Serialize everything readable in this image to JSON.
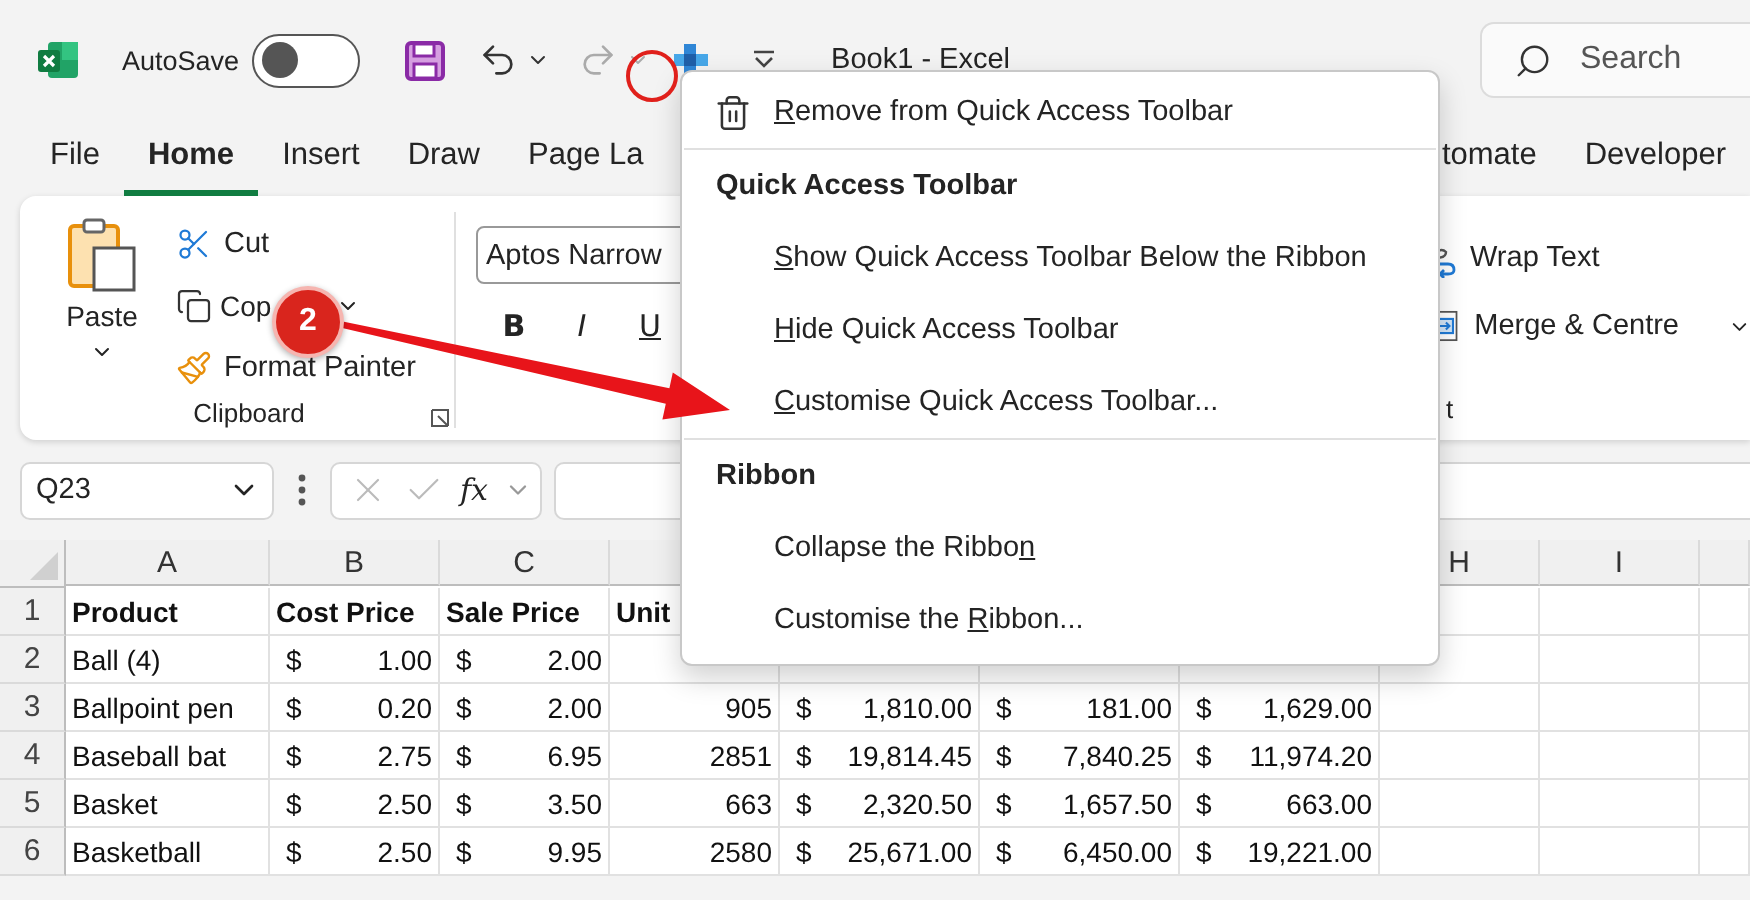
{
  "title_bar": {
    "autosave_label": "AutoSave",
    "autosave_on": false,
    "title": "Book1  -  Excel",
    "search": {
      "placeholder": "Search"
    }
  },
  "tabs": [
    {
      "label": "File",
      "selected": false
    },
    {
      "label": "Home",
      "selected": true
    },
    {
      "label": "Insert",
      "selected": false
    },
    {
      "label": "Draw",
      "selected": false
    },
    {
      "label": "Page La",
      "selected": false
    },
    {
      "label": "tomate",
      "selected": false
    },
    {
      "label": "Developer",
      "selected": false
    }
  ],
  "ribbon": {
    "clipboard": {
      "paste": "Paste",
      "cut": "Cut",
      "copy": "Cop",
      "format_painter": "Format Painter",
      "label": "Clipboard"
    },
    "font": {
      "name": "Aptos Narrow",
      "bold": "B",
      "italic": "I",
      "underline": "U"
    },
    "alignment": {
      "wrap_text": "Wrap Text",
      "merge": "Merge & Centre",
      "label": "t"
    }
  },
  "formula_bar": {
    "name_box": "Q23",
    "fx": "fx"
  },
  "sheet": {
    "columns": [
      "A",
      "B",
      "C",
      "H",
      "I"
    ],
    "rows": [
      {
        "number": "1",
        "cells": [
          {
            "kind": "header",
            "text": "Product"
          },
          {
            "kind": "header",
            "text": "Cost Price"
          },
          {
            "kind": "header",
            "text": "Sale Price"
          },
          {
            "kind": "header",
            "text": "Unit"
          }
        ]
      },
      {
        "number": "2",
        "cells": [
          {
            "kind": "text",
            "text": "Ball (4)"
          },
          {
            "kind": "currency",
            "symbol": "$",
            "amount": "1.00"
          },
          {
            "kind": "currency",
            "symbol": "$",
            "amount": "2.00"
          }
        ]
      },
      {
        "number": "3",
        "cells": [
          {
            "kind": "text",
            "text": "Ballpoint pen"
          },
          {
            "kind": "currency",
            "symbol": "$",
            "amount": "0.20"
          },
          {
            "kind": "currency",
            "symbol": "$",
            "amount": "2.00"
          },
          {
            "kind": "number",
            "text": "905"
          },
          {
            "kind": "currency",
            "symbol": "$",
            "amount": "1,810.00"
          },
          {
            "kind": "currency",
            "symbol": "$",
            "amount": "181.00"
          },
          {
            "kind": "currency",
            "symbol": "$",
            "amount": "1,629.00"
          }
        ]
      },
      {
        "number": "4",
        "cells": [
          {
            "kind": "text",
            "text": "Baseball bat"
          },
          {
            "kind": "currency",
            "symbol": "$",
            "amount": "2.75"
          },
          {
            "kind": "currency",
            "symbol": "$",
            "amount": "6.95"
          },
          {
            "kind": "number",
            "text": "2851"
          },
          {
            "kind": "currency",
            "symbol": "$",
            "amount": "19,814.45"
          },
          {
            "kind": "currency",
            "symbol": "$",
            "amount": "7,840.25"
          },
          {
            "kind": "currency",
            "symbol": "$",
            "amount": "11,974.20"
          }
        ]
      },
      {
        "number": "5",
        "cells": [
          {
            "kind": "text",
            "text": "Basket"
          },
          {
            "kind": "currency",
            "symbol": "$",
            "amount": "2.50"
          },
          {
            "kind": "currency",
            "symbol": "$",
            "amount": "3.50"
          },
          {
            "kind": "number",
            "text": "663"
          },
          {
            "kind": "currency",
            "symbol": "$",
            "amount": "2,320.50"
          },
          {
            "kind": "currency",
            "symbol": "$",
            "amount": "1,657.50"
          },
          {
            "kind": "currency",
            "symbol": "$",
            "amount": "663.00"
          }
        ]
      },
      {
        "number": "6",
        "cells": [
          {
            "kind": "text",
            "text": "Basketball"
          },
          {
            "kind": "currency",
            "symbol": "$",
            "amount": "2.50"
          },
          {
            "kind": "currency",
            "symbol": "$",
            "amount": "9.95"
          },
          {
            "kind": "number",
            "text": "2580"
          },
          {
            "kind": "currency",
            "symbol": "$",
            "amount": "25,671.00"
          },
          {
            "kind": "currency",
            "symbol": "$",
            "amount": "6,450.00"
          },
          {
            "kind": "currency",
            "symbol": "$",
            "amount": "19,221.00"
          }
        ]
      }
    ]
  },
  "context_menu": {
    "items": [
      {
        "kind": "item",
        "key": "R",
        "after": "emove from Quick Access Toolbar"
      },
      {
        "kind": "divider"
      },
      {
        "kind": "header",
        "text": "Quick Access Toolbar"
      },
      {
        "kind": "item",
        "key": "S",
        "after": "how Quick Access Toolbar Below the Ribbon"
      },
      {
        "kind": "item",
        "key": "H",
        "after": "ide Quick Access Toolbar"
      },
      {
        "kind": "item",
        "key": "C",
        "after": "ustomise Quick Access Toolbar..."
      },
      {
        "kind": "divider"
      },
      {
        "kind": "header",
        "text": "Ribbon"
      },
      {
        "kind": "item",
        "before": "Collapse the Ribbo",
        "key": "n"
      },
      {
        "kind": "item",
        "before": "Customise the ",
        "key": "R",
        "after": "ibbon..."
      }
    ]
  },
  "annotation": {
    "step": "2"
  }
}
